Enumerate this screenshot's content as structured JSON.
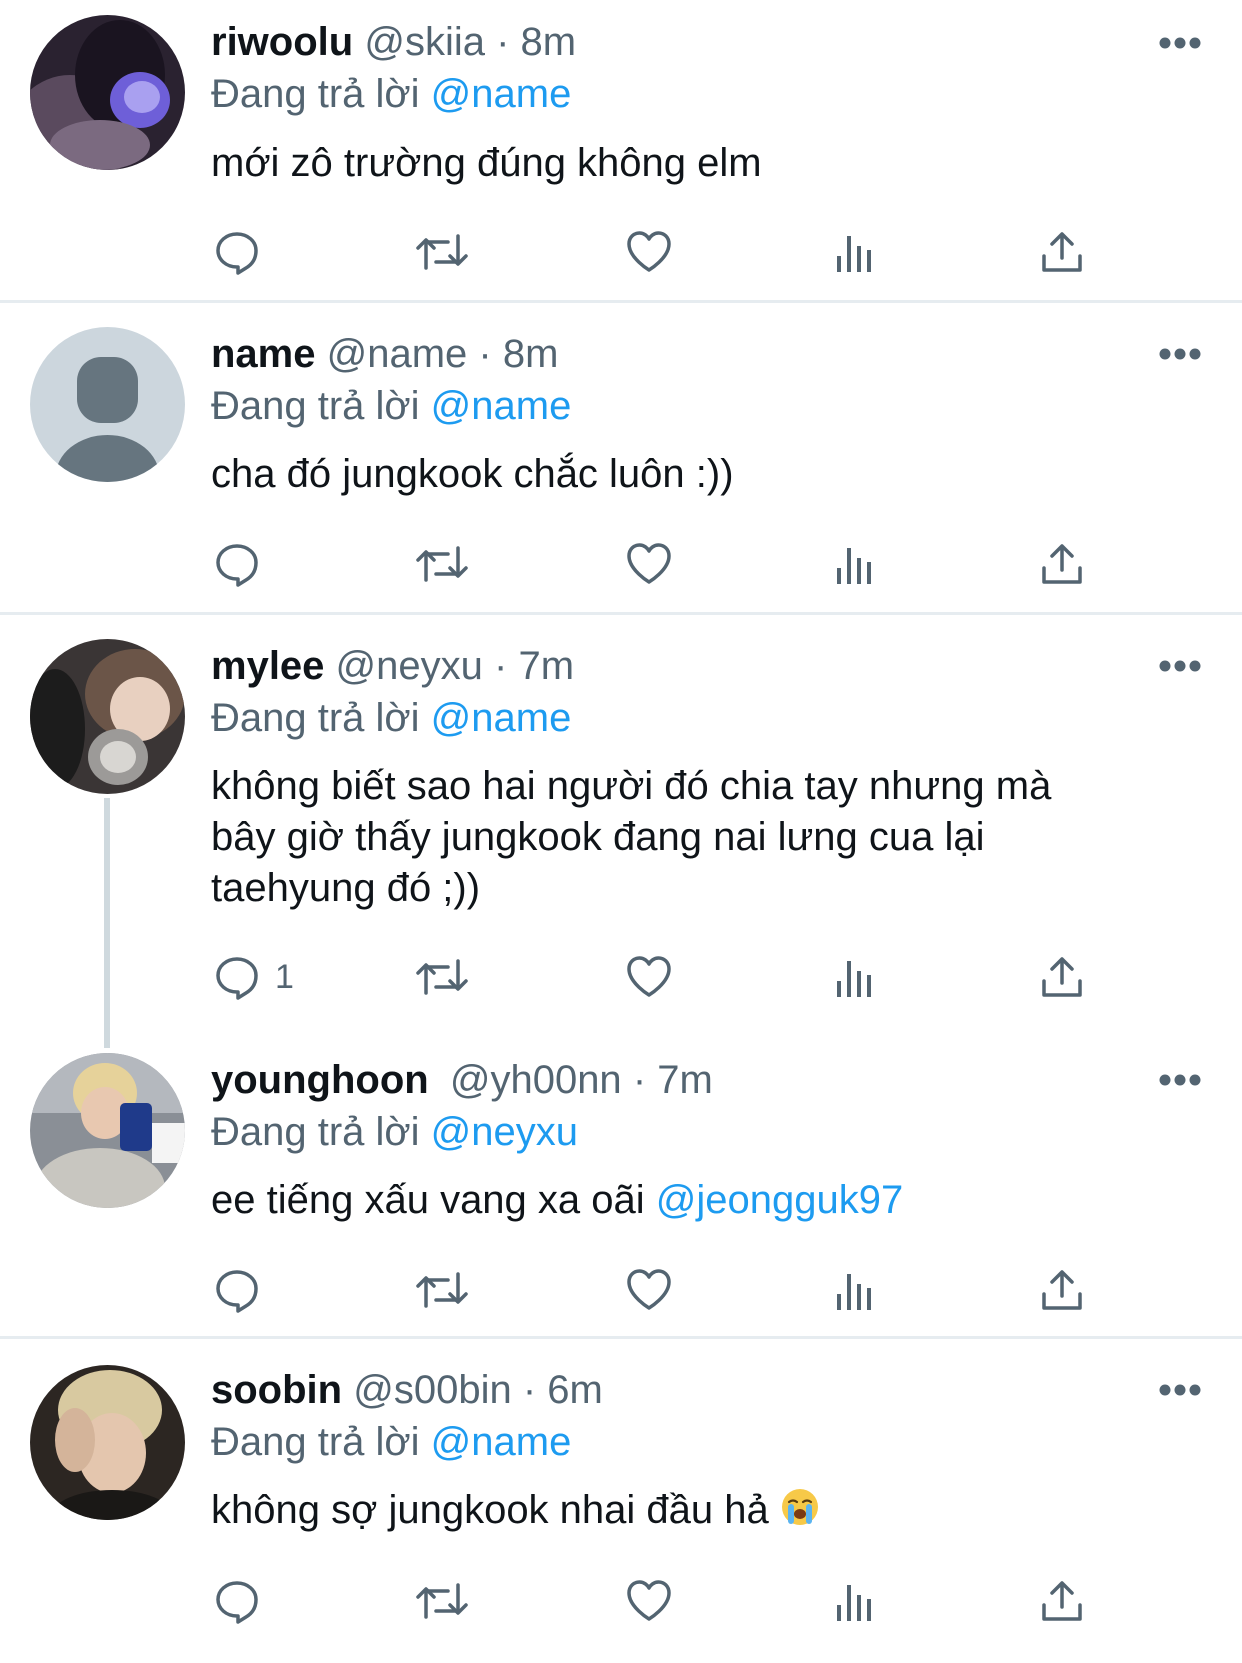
{
  "replying_label": "Đang trả lời",
  "tweets": [
    {
      "display_name": "riwoolu",
      "handle": "@skiia",
      "time": "· 8m",
      "reply_to": "@name",
      "text": "mới zô trường đúng không elm",
      "avatar": "avatar-photo-girl-purple"
    },
    {
      "display_name": "name",
      "handle": "@name",
      "time": "· 8m",
      "reply_to": "@name",
      "text": "cha đó jungkook chắc luôn :))",
      "avatar": "default-person-icon"
    },
    {
      "display_name": "mylee",
      "handle": "@neyxu",
      "time": "· 7m",
      "reply_to": "@name",
      "text_lines": [
        "không biết sao hai người đó chia tay nhưng mà",
        "bây giờ thấy jungkook đang nai lưng cua lại",
        "taehyung đó ;))"
      ],
      "reply_count": "1",
      "avatar": "avatar-photo-girl-cat"
    },
    {
      "display_name": "younghoon",
      "handle": "@yh00nn",
      "time": "· 7m",
      "reply_to": "@neyxu",
      "text": "ee tiếng xấu vang xa oãi ",
      "text_mention": "@jeongguk97",
      "avatar": "avatar-photo-boy-selfie"
    },
    {
      "display_name": "soobin",
      "handle": "@s00bin",
      "time": "· 6m",
      "reply_to": "@name",
      "text": "không sợ jungkook nhai đầu hả ",
      "emoji": "loudly-crying-face-icon",
      "avatar": "avatar-photo-boy-blond"
    }
  ],
  "icons": {
    "reply": "reply-icon",
    "retweet": "retweet-icon",
    "like": "like-icon",
    "views": "views-icon",
    "share": "share-icon",
    "more": "more-icon"
  },
  "colors": {
    "text": "#0f1419",
    "secondary": "#536471",
    "mention": "#1d9bf0",
    "divider": "#e6ecf0"
  }
}
